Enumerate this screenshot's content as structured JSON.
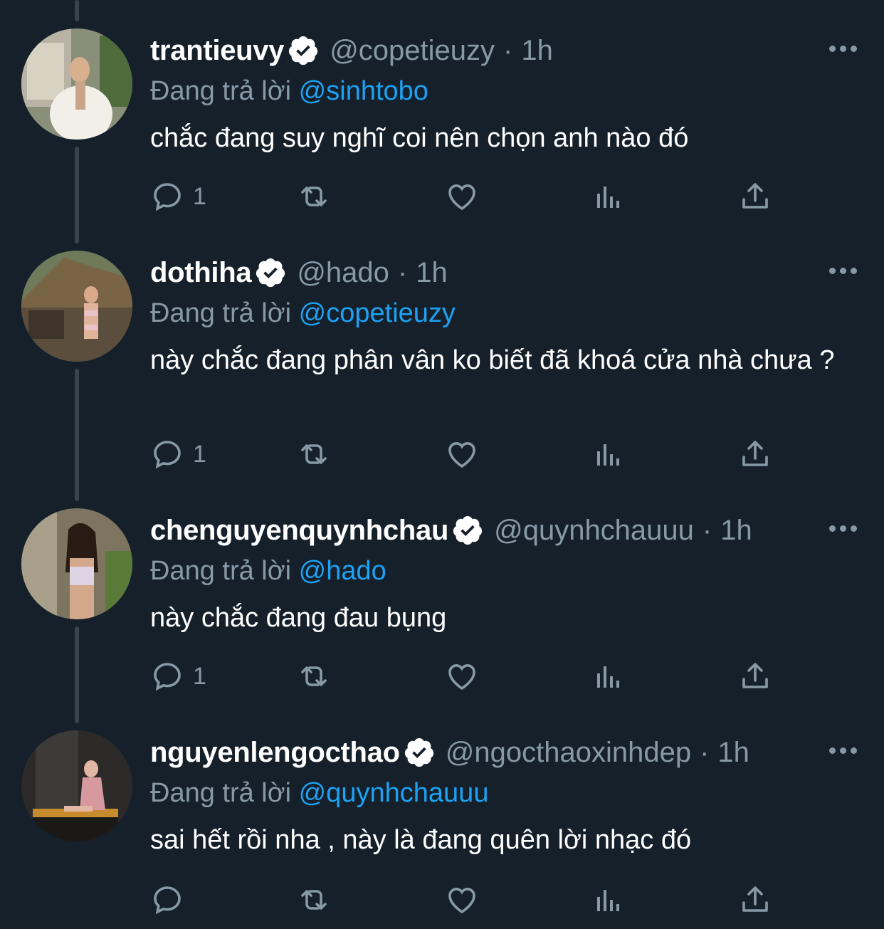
{
  "colors": {
    "background": "#15202b",
    "secondary_text": "#8899a6",
    "mention": "#1da1f2",
    "thread_line": "#38444d"
  },
  "tweets": [
    {
      "display_name": "trantieuvy",
      "handle": "@copetieuzy",
      "separator": "·",
      "time": "1h",
      "replying_label": "Đang trả lời",
      "replying_to": "@sinhtobo",
      "text": "chắc đang suy nghĩ coi nên chọn anh nào đó",
      "reply_count": "1",
      "verified": true
    },
    {
      "display_name": "dothiha",
      "handle": "@hado",
      "separator": "·",
      "time": "1h",
      "replying_label": "Đang trả lời",
      "replying_to": "@copetieuzy",
      "text": "này chắc đang phân vân ko biết đã khoá cửa nhà chưa ?",
      "reply_count": "1",
      "verified": true
    },
    {
      "display_name": "chenguyenquynhchau",
      "handle": "@quynhchauuu",
      "separator": "·",
      "time": "1h",
      "replying_label": "Đang trả lời",
      "replying_to": "@hado",
      "text": "này chắc đang đau bụng",
      "reply_count": "1",
      "verified": true
    },
    {
      "display_name": "nguyenlengocthao",
      "handle": "@ngocthaoxinhdep",
      "separator": "·",
      "time": "1h",
      "replying_label": "Đang trả lời",
      "replying_to": "@quynhchauuu",
      "text": "sai hết rồi nha , này là đang quên lời nhạc đó",
      "reply_count": "",
      "verified": true
    }
  ],
  "icons": {
    "reply": "reply-icon",
    "retweet": "retweet-icon",
    "like": "heart-icon",
    "analytics": "analytics-icon",
    "share": "share-icon",
    "more": "more-icon",
    "verified": "verified-badge-icon"
  }
}
